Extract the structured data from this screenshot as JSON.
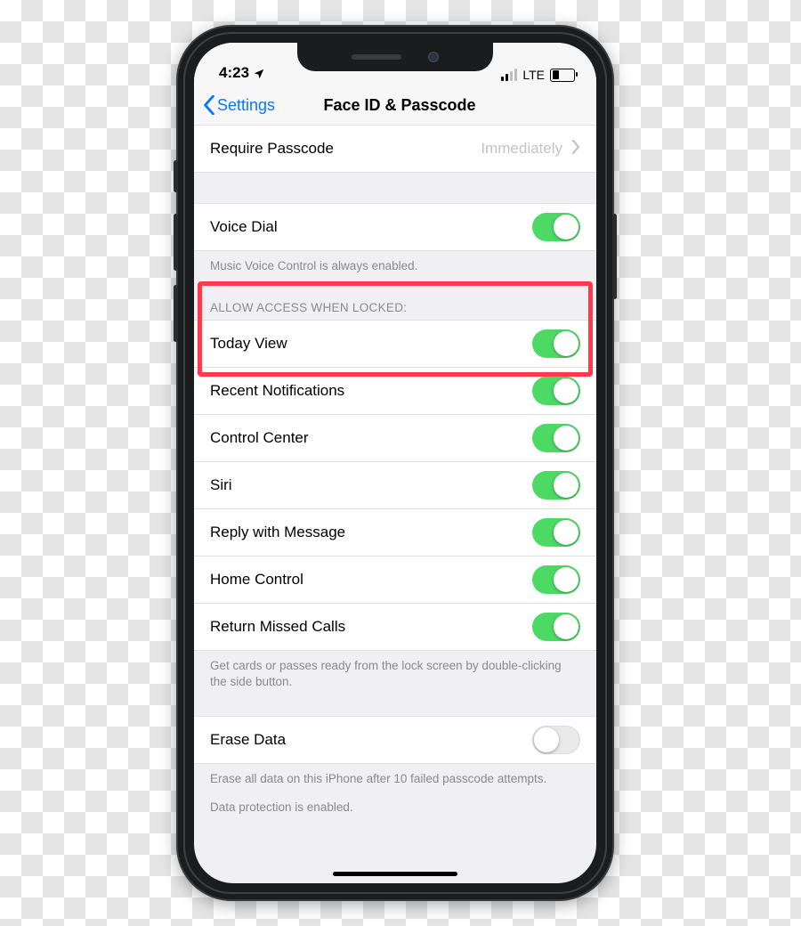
{
  "status": {
    "time": "4:23",
    "network_label": "LTE"
  },
  "nav": {
    "back_label": "Settings",
    "title": "Face ID & Passcode"
  },
  "require": {
    "label": "Require Passcode",
    "value": "Immediately"
  },
  "voice_dial": {
    "label": "Voice Dial",
    "on": true,
    "footer": "Music Voice Control is always enabled."
  },
  "allow_section": {
    "header": "ALLOW ACCESS WHEN LOCKED:",
    "items": [
      {
        "label": "Today View",
        "on": true
      },
      {
        "label": "Recent Notifications",
        "on": true
      },
      {
        "label": "Control Center",
        "on": true
      },
      {
        "label": "Siri",
        "on": true
      },
      {
        "label": "Reply with Message",
        "on": true
      },
      {
        "label": "Home Control",
        "on": true
      },
      {
        "label": "Return Missed Calls",
        "on": true
      }
    ],
    "footer": "Get cards or passes ready from the lock screen by double-clicking the side button."
  },
  "erase": {
    "label": "Erase Data",
    "on": false,
    "footer1": "Erase all data on this iPhone after 10 failed passcode attempts.",
    "footer2": "Data protection is enabled."
  },
  "highlight_index": 0
}
